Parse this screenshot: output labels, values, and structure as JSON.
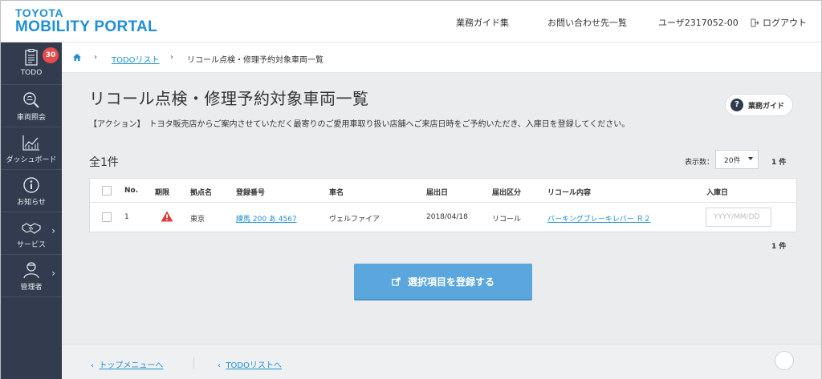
{
  "brand": {
    "line1": "TOYOTA",
    "line2": "MOBILITY PORTAL"
  },
  "header_nav": {
    "guide": "業務ガイド集",
    "contacts": "お問い合わせ先一覧",
    "user": "ユーザ2317052-00",
    "logout": "ログアウト"
  },
  "sidebar": {
    "todo_badge": "30",
    "items": [
      {
        "label": "TODO",
        "icon": "todo-clipboard-icon"
      },
      {
        "label": "車両照会",
        "icon": "vehicle-search-icon"
      },
      {
        "label": "ダッシュボード",
        "icon": "chart-icon"
      },
      {
        "label": "お知らせ",
        "icon": "info-icon"
      },
      {
        "label": "サービス",
        "icon": "handshake-icon"
      },
      {
        "label": "管理者",
        "icon": "admin-person-icon"
      }
    ]
  },
  "breadcrumb": {
    "home_icon": "home-icon",
    "todo_link": "TODOリスト",
    "current": "リコール点検・修理予約対象車両一覧"
  },
  "page": {
    "title": "リコール点検・修理予約対象車両一覧",
    "action_text": "【アクション】　トヨタ販売店からご案内させていただく最寄りのご愛用車取り扱い店舗へご来店日時をご予約いただき、入庫日を登録してください。",
    "guide_button": "業務ガイド",
    "count_label": "全1件",
    "per_page_label": "表示数：",
    "per_page_value": "20件",
    "total_label_top": "1 件",
    "total_label_bottom": "1 件"
  },
  "table": {
    "headers": {
      "no": "No.",
      "deadline": "期限",
      "base": "拠点名",
      "reg": "登録番号",
      "car": "車名",
      "date": "届出日",
      "type": "届出区分",
      "recall": "リコール内容",
      "entry": "入庫日"
    },
    "rows": [
      {
        "no": "1",
        "base": "東京",
        "reg": "練馬 200 あ 4567",
        "car": "ヴェルファイア",
        "date": "2018/04/18",
        "type": "リコール",
        "recall": "パーキングブレーキレバー Ｒ２",
        "entry_placeholder": "YYYY/MM/DD"
      }
    ]
  },
  "submit_button": "選択項目を登録する",
  "footer": {
    "top_menu": "トップメニューへ",
    "todo_back": "TODOリストへ"
  },
  "colors": {
    "accent": "#1f8fd6",
    "sidebar": "#323c4e",
    "button": "#5aa6dd",
    "badge": "#e74a4a",
    "warning": "#e03c3c"
  }
}
